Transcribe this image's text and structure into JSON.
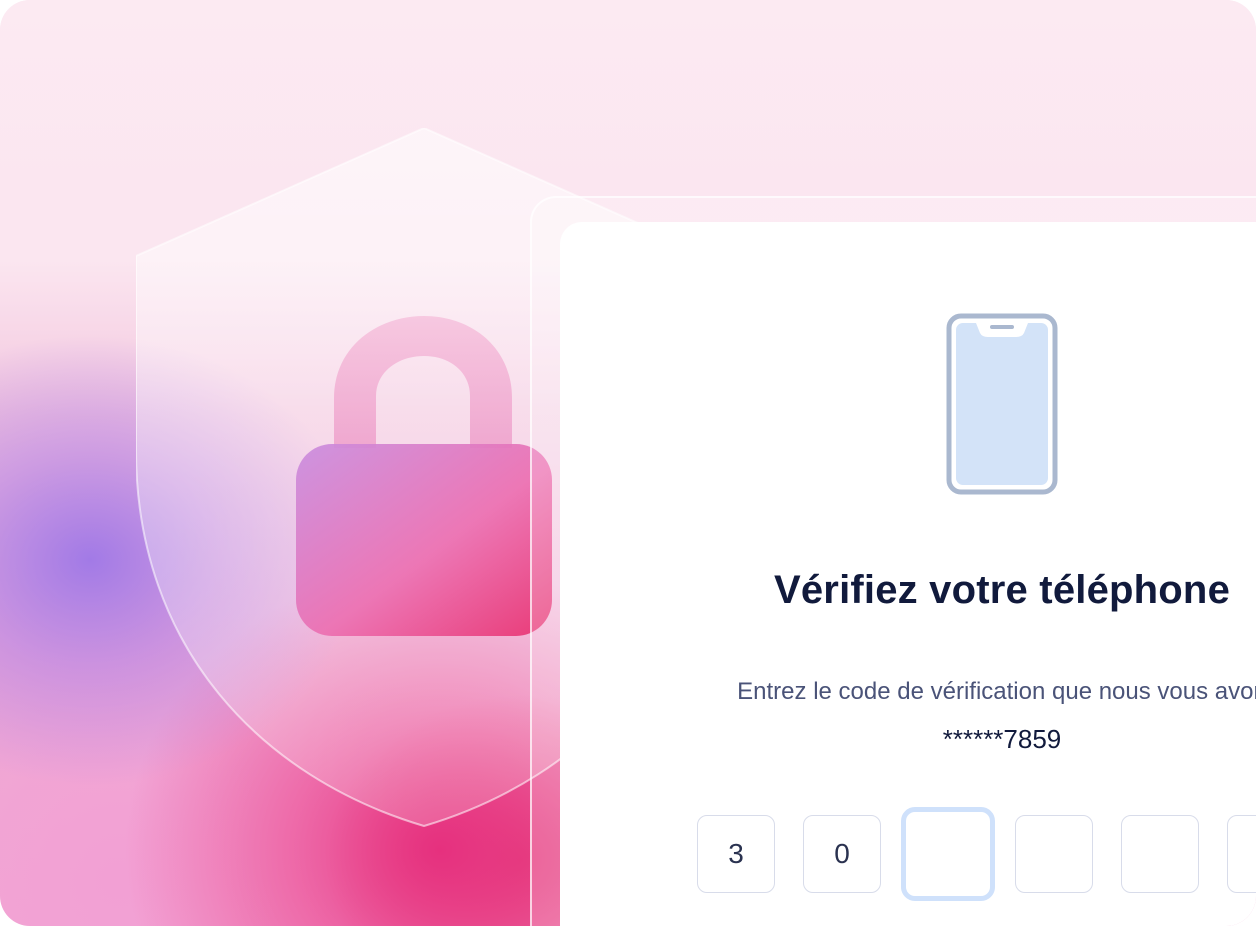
{
  "verification": {
    "title": "Vérifiez votre téléphone",
    "subtitle": "Entrez le code de vérification que nous vous avon",
    "masked_phone": "******7859",
    "code_digits": [
      "3",
      "0",
      "",
      "",
      "",
      ""
    ],
    "active_index": 2
  },
  "icons": {
    "shield": "shield-icon",
    "lock": "lock-icon",
    "phone": "phone-icon"
  },
  "colors": {
    "title": "#111a3c",
    "subtitle": "#4a5378",
    "focus_ring": "#cfe1fb",
    "phone_screen": "#d3e3f8",
    "phone_frame": "#aab8cf"
  }
}
